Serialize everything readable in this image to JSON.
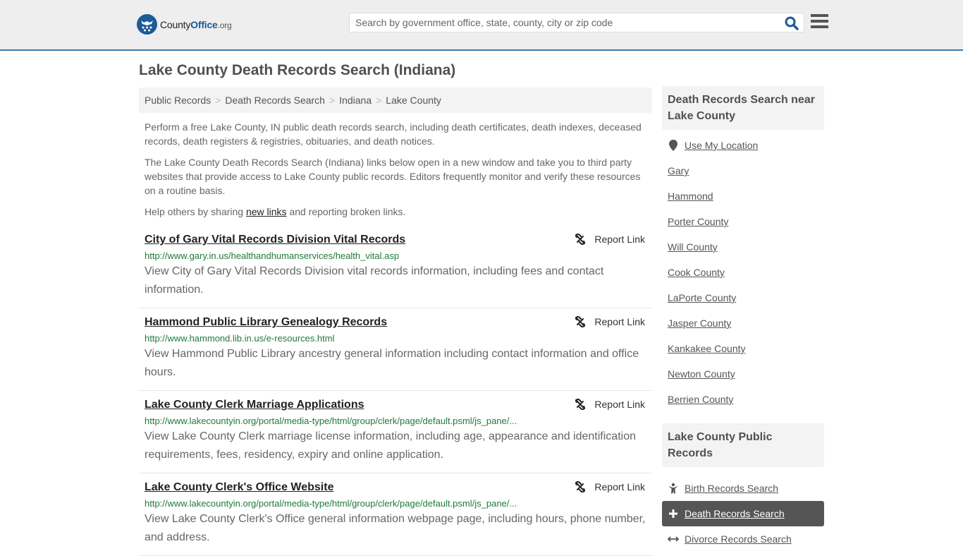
{
  "header": {
    "logo": {
      "prefix": "County",
      "brand": "Office",
      "tld": ".org"
    },
    "search": {
      "placeholder": "Search by government office, state, county, city or zip code",
      "value": ""
    },
    "icons": {
      "search": "search-icon",
      "menu": "hamburger-menu-icon"
    }
  },
  "page": {
    "title": "Lake County Death Records Search (Indiana)"
  },
  "breadcrumb": [
    {
      "label": "Public Records"
    },
    {
      "label": "Death Records Search"
    },
    {
      "label": "Indiana"
    },
    {
      "label": "Lake County"
    }
  ],
  "breadcrumb_separator": ">",
  "intro": {
    "p1": "Perform a free Lake County, IN public death records search, including death certificates, death indexes, deceased records, death registers & registries, obituaries, and death notices.",
    "p2": "The Lake County Death Records Search (Indiana) links below open in a new window and take you to third party websites that provide access to Lake County public records. Editors frequently monitor and verify these resources on a routine basis.",
    "p3_before": "Help others by sharing ",
    "p3_link": "new links",
    "p3_after": " and reporting broken links."
  },
  "results": [
    {
      "title": "City of Gary Vital Records Division Vital Records",
      "url": "http://www.gary.in.us/healthandhumanservices/health_vital.asp",
      "description": "View City of Gary Vital Records Division vital records information, including fees and contact information.",
      "report_label": "Report Link"
    },
    {
      "title": "Hammond Public Library Genealogy Records",
      "url": "http://www.hammond.lib.in.us/e-resources.html",
      "description": "View Hammond Public Library ancestry general information including contact information and office hours.",
      "report_label": "Report Link"
    },
    {
      "title": "Lake County Clerk Marriage Applications",
      "url": "http://www.lakecountyin.org/portal/media-type/html/group/clerk/page/default.psml/js_pane/...",
      "description": "View Lake County Clerk marriage license information, including age, appearance and identification requirements, fees, residency, expiry and online application.",
      "report_label": "Report Link"
    },
    {
      "title": "Lake County Clerk's Office Website",
      "url": "http://www.lakecountyin.org/portal/media-type/html/group/clerk/page/default.psml/js_pane/...",
      "description": "View Lake County Clerk's Office general information webpage page, including hours, phone number, and address.",
      "report_label": "Report Link"
    }
  ],
  "sidebar": {
    "nearby": {
      "heading": "Death Records Search near Lake County",
      "use_location": "Use My Location",
      "items": [
        "Gary",
        "Hammond",
        "Porter County",
        "Will County",
        "Cook County",
        "LaPorte County",
        "Jasper County",
        "Kankakee County",
        "Newton County",
        "Berrien County"
      ]
    },
    "public_records": {
      "heading": "Lake County Public Records",
      "items": [
        {
          "label": "Birth Records Search",
          "icon": "baby-icon",
          "active": false
        },
        {
          "label": "Death Records Search",
          "icon": "plus-cross-icon",
          "active": true
        },
        {
          "label": "Divorce Records Search",
          "icon": "arrows-horizontal-icon",
          "active": false
        }
      ]
    }
  },
  "colors": {
    "brand_blue": "#1c5a9a",
    "header_border": "#3a78a8",
    "url_green": "#1f7a3a",
    "active_bg": "#555555"
  }
}
